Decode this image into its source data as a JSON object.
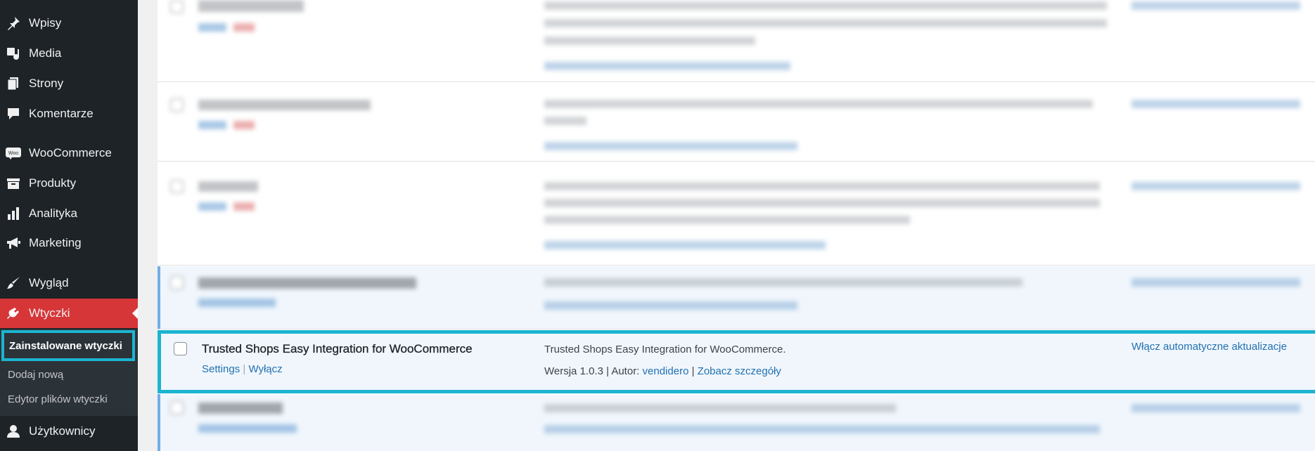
{
  "sidebar": {
    "items": [
      {
        "label": "Wpisy",
        "icon": "pin-icon"
      },
      {
        "label": "Media",
        "icon": "media-icon"
      },
      {
        "label": "Strony",
        "icon": "pages-icon"
      },
      {
        "label": "Komentarze",
        "icon": "comments-icon"
      },
      {
        "label": "WooCommerce",
        "icon": "woocommerce-icon"
      },
      {
        "label": "Produkty",
        "icon": "products-icon"
      },
      {
        "label": "Analityka",
        "icon": "analytics-icon"
      },
      {
        "label": "Marketing",
        "icon": "megaphone-icon"
      },
      {
        "label": "Wygląd",
        "icon": "brush-icon"
      },
      {
        "label": "Wtyczki",
        "icon": "plugin-icon"
      },
      {
        "label": "Użytkownicy",
        "icon": "user-icon"
      }
    ],
    "submenu": [
      {
        "label": "Zainstalowane wtyczki"
      },
      {
        "label": "Dodaj nową"
      },
      {
        "label": "Edytor plików wtyczki"
      }
    ],
    "active_color": "#d63638",
    "highlight_color": "#1bb5d0"
  },
  "plugins": {
    "highlighted": {
      "name": "Trusted Shops Easy Integration for WooCommerce",
      "action_settings": "Settings",
      "action_sep": "|",
      "action_deactivate": "Wyłącz",
      "description": "Trusted Shops Easy Integration for WooCommerce.",
      "version_text": "Wersja 1.0.3 | Autor: ",
      "author": "vendidero",
      "sep": " | ",
      "details_link": "Zobacz szczegóły",
      "auto_update": "Włącz automatyczne aktualizacje"
    }
  }
}
